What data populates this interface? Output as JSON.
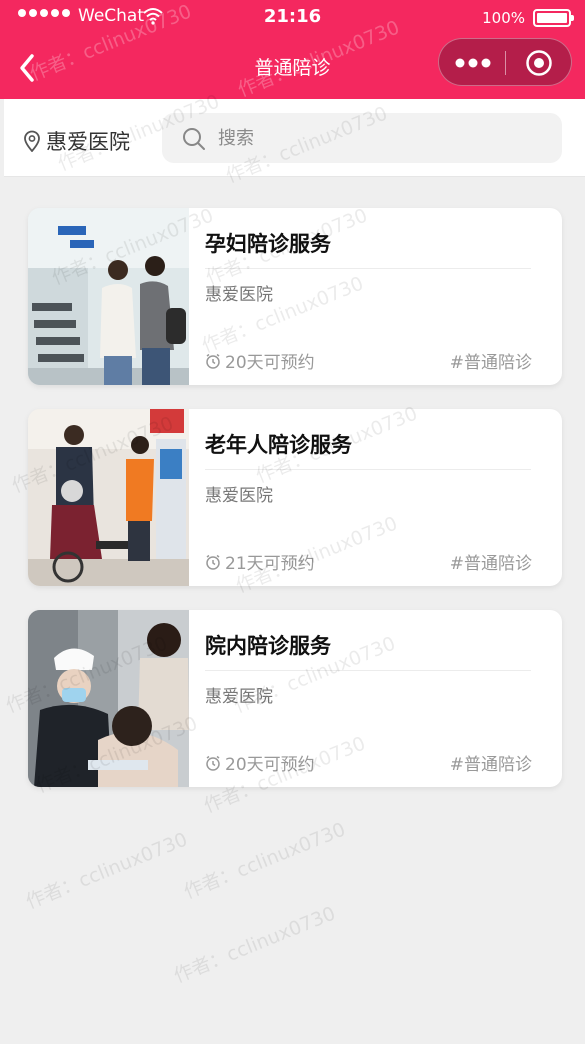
{
  "status_bar": {
    "carrier": "WeChat",
    "time": "21:16",
    "battery": "100%"
  },
  "nav": {
    "title": "普通陪诊"
  },
  "header": {
    "location": "惠爱医院",
    "search_placeholder": "搜索"
  },
  "services": [
    {
      "name": "孕妇陪诊服务",
      "hospital": "惠爱医院",
      "availability": "20天可预约",
      "tag": "#普通陪诊"
    },
    {
      "name": "老年人陪诊服务",
      "hospital": "惠爱医院",
      "availability": "21天可预约",
      "tag": "#普通陪诊"
    },
    {
      "name": "院内陪诊服务",
      "hospital": "惠爱医院",
      "availability": "20天可预约",
      "tag": "#普通陪诊"
    }
  ],
  "watermark": "作者：cclinux0730",
  "colors": {
    "brand": "#f4285f",
    "capsule": "#b41e4a"
  }
}
